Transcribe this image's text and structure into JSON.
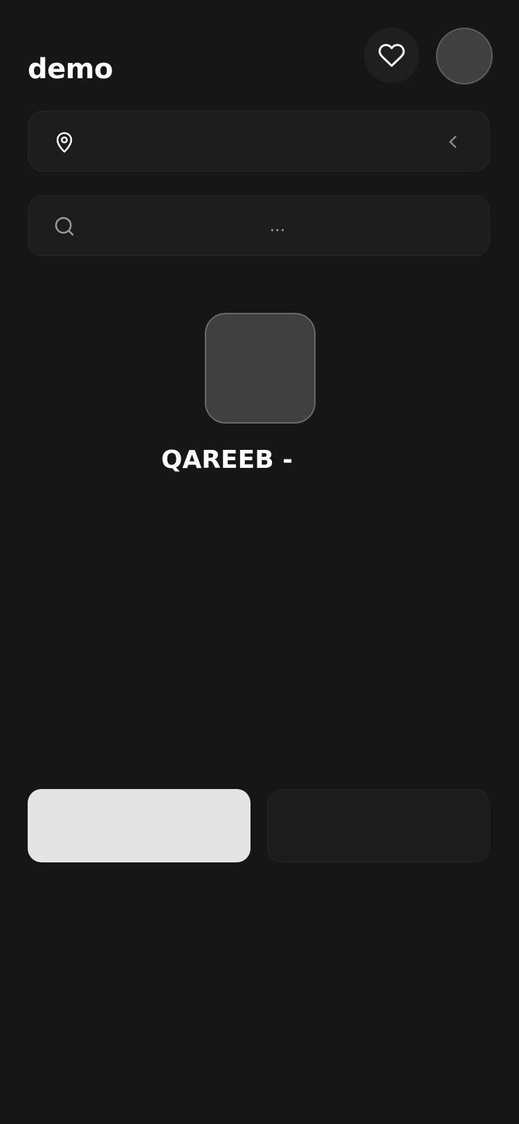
{
  "header": {
    "title": "demo"
  },
  "icons": {
    "favorite": "heart-icon",
    "location": "map-pin-icon",
    "location_chevron": "chevron-left-icon",
    "search": "search-icon"
  },
  "location": {
    "value": ""
  },
  "search": {
    "placeholder": "..."
  },
  "brand": {
    "name": "QAREEB -"
  },
  "actions": {
    "primary_label": "",
    "secondary_label": ""
  },
  "colors": {
    "background": "#161616",
    "field_background": "#1d1d1d",
    "primary_button": "#e4e4e5",
    "secondary_button": "#1c1c1c",
    "placeholder_box": "#404040"
  }
}
